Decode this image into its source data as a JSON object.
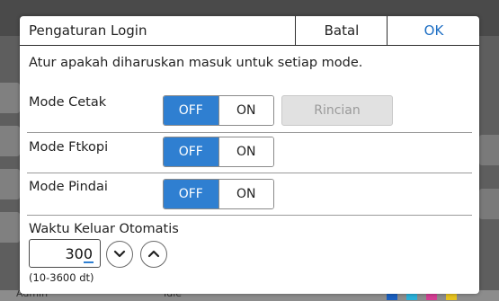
{
  "dialog": {
    "title": "Pengaturan Login",
    "cancel_label": "Batal",
    "ok_label": "OK",
    "description": "Atur apakah diharuskan masuk untuk setiap mode."
  },
  "modes": [
    {
      "label": "Mode Cetak",
      "off_label": "OFF",
      "on_label": "ON",
      "selected": "OFF"
    },
    {
      "label": "Mode Ftkopi",
      "off_label": "OFF",
      "on_label": "ON",
      "selected": "OFF"
    },
    {
      "label": "Mode Pindai",
      "off_label": "OFF",
      "on_label": "ON",
      "selected": "OFF"
    }
  ],
  "detail_button_label": "Rincian",
  "auto_logout": {
    "label": "Waktu Keluar Otomatis",
    "value": "300",
    "range": "(10-3600 dt)",
    "decrement_icon": "chevron-down-icon",
    "increment_icon": "chevron-up-icon"
  },
  "background": {
    "user": "Admin",
    "status": "Idle"
  },
  "colors": {
    "accent": "#2f7fd1",
    "ok_text": "#1e6fc4",
    "disabled_bg": "#e1e1e1"
  }
}
